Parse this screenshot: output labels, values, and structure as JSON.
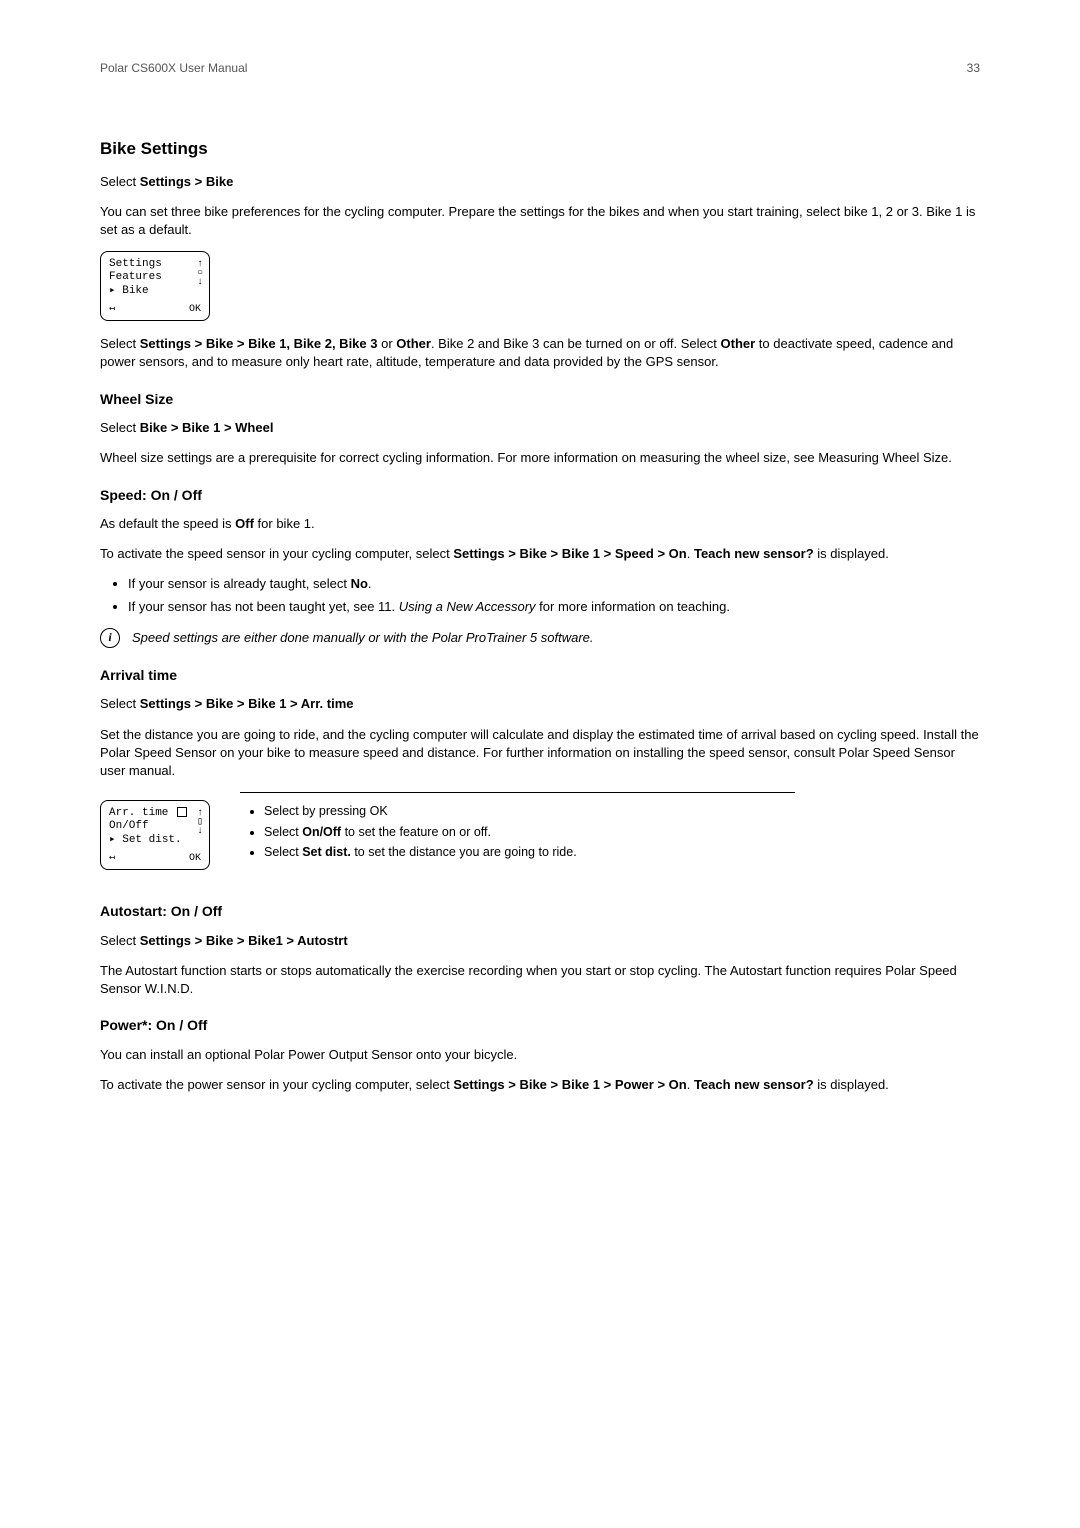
{
  "header": {
    "left": "Polar CS600X User Manual",
    "page": "33"
  },
  "bike_settings": {
    "title": "Bike Settings",
    "select_prefix": "Select ",
    "select_path": "Settings > Bike",
    "intro": "You can set three bike preferences for the cycling computer. Prepare the settings for the bikes and when you start training, select bike 1, 2 or 3. Bike 1 is set as a default.",
    "screen": {
      "l1": "Settings",
      "l2": " Features",
      "l3": "▸ Bike",
      "ok": "OK"
    },
    "p2_a": "Select ",
    "p2_b": "Settings > Bike > Bike 1, Bike 2, Bike 3",
    "p2_c": " or ",
    "p2_d": "Other",
    "p2_e": ". Bike 2 and Bike 3 can be turned on or off. Select ",
    "p2_f": "Other",
    "p2_g": " to deactivate speed, cadence and power sensors, and to measure only heart rate, altitude, temperature and data provided by the GPS sensor."
  },
  "wheel": {
    "title": "Wheel Size",
    "select_prefix": "Select ",
    "select_path": "Bike > Bike 1 > Wheel",
    "body": "Wheel size settings are a prerequisite for correct cycling information. For more information on measuring the wheel size, see Measuring Wheel Size."
  },
  "speed": {
    "title": "Speed: On / Off",
    "p1_a": "As default the speed is ",
    "p1_b": "Off",
    "p1_c": " for bike 1.",
    "p2_a": "To activate the speed sensor in your cycling computer, select ",
    "p2_b": "Settings > Bike > Bike 1 > Speed > On",
    "p2_c": ". ",
    "p2_d": "Teach new sensor?",
    "p2_e": " is displayed.",
    "li1_a": "If your sensor is already taught, select ",
    "li1_b": "No",
    "li1_c": ".",
    "li2_a": "If your sensor has not been taught yet, see 11. ",
    "li2_b": "Using a New Accessory",
    "li2_c": " for more information on teaching.",
    "note": "Speed settings are either done manually or with the Polar ProTrainer 5 software."
  },
  "arrival": {
    "title": "Arrival time",
    "select_prefix": "Select ",
    "select_path": "Settings > Bike > Bike 1 > Arr. time",
    "body": "Set the distance you are going to ride, and the cycling computer will calculate and display the estimated time of arrival based on cycling speed. Install the Polar Speed Sensor on your bike to measure speed and distance. For further information on installing the speed sensor, consult Polar Speed Sensor user manual.",
    "screen": {
      "l1": "Arr. time",
      "l2": " On/Off",
      "l3": "▸ Set dist.",
      "ok": "OK"
    },
    "li1": "Select by pressing OK",
    "li2_a": "Select ",
    "li2_b": "On/Off",
    "li2_c": " to set the feature on or off.",
    "li3_a": "Select ",
    "li3_b": "Set dist.",
    "li3_c": " to set the distance you are going to ride."
  },
  "autostart": {
    "title": "Autostart: On / Off",
    "select_prefix": "Select ",
    "select_path": "Settings > Bike > Bike1 > Autostrt",
    "body": "The Autostart function starts or stops automatically the exercise recording when you start or stop cycling. The Autostart function requires Polar Speed Sensor W.I.N.D."
  },
  "power": {
    "title": "Power*: On / Off",
    "p1": "You can install an optional Polar Power Output Sensor onto your bicycle.",
    "p2_a": "To activate the power sensor in your cycling computer, select ",
    "p2_b": "Settings > Bike > Bike 1 > Power > On",
    "p2_c": ". ",
    "p2_d": "Teach new sensor?",
    "p2_e": " is displayed."
  }
}
